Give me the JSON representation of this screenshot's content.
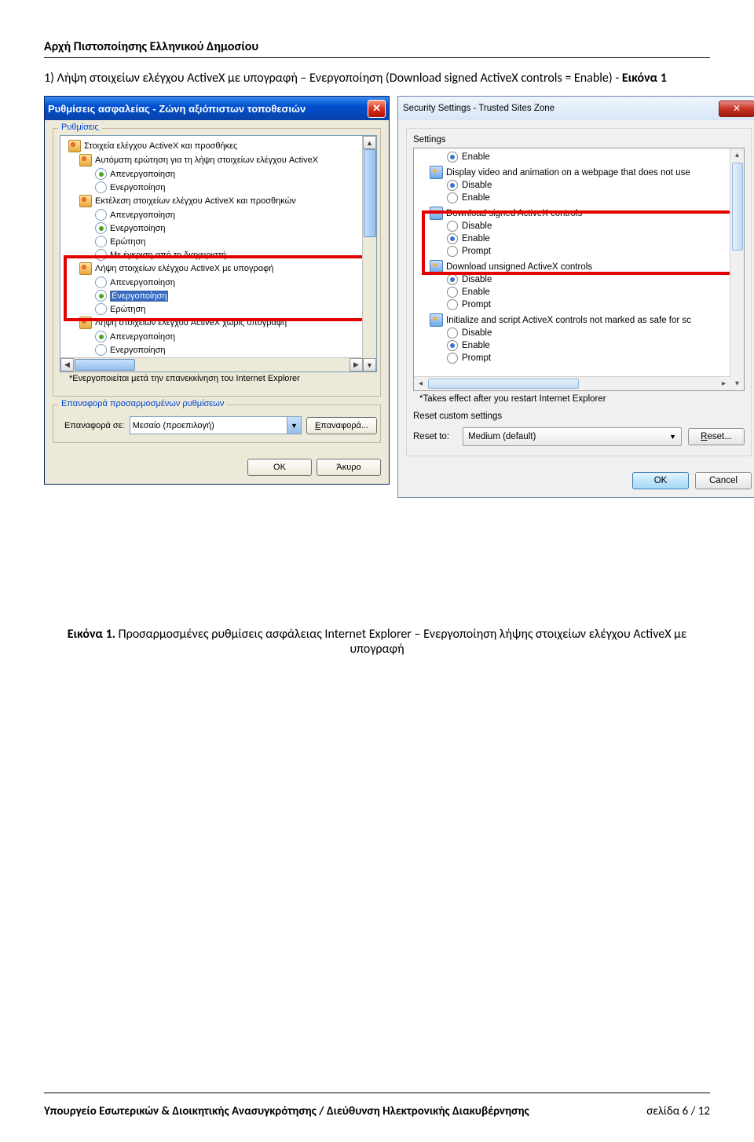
{
  "header": "Αρχή Πιστοποίησης Ελληνικού Δημοσίου",
  "paragraph_pre": "1) Λήψη στοιχείων ελέγχου ActiveX με υπογραφή – Ενεργοποίηση (Download signed ActiveX controls = Enable) - ",
  "paragraph_fig": "Εικόνα 1",
  "caption_lead": "Εικόνα 1.",
  "caption_rest": " Προσαρμοσμένες ρυθμίσεις ασφάλειας Internet Explorer – Ενεργοποίηση λήψης στοιχείων ελέγχου ActiveX με υπογραφή",
  "footer_left": "Υπουργείο Εσωτερικών & Διοικητικής Ανασυγκρότησης / Διεύθυνση Ηλεκτρονικής Διακυβέρνησης",
  "footer_right": "σελίδα 6 / 12",
  "dlg1": {
    "title": "Ρυθμίσεις ασφαλείας - Ζώνη αξιόπιστων τοποθεσιών",
    "group": "Ρυθμίσεις",
    "note": "*Ενεργοποιείται μετά την επανεκκίνηση του Internet Explorer",
    "reset_group": "Επαναφορά προσαρμοσμένων ρυθμίσεων",
    "reset_label": "Επαναφορά σε:",
    "reset_value": "Μεσαίο (προεπιλογή)",
    "reset_btn": "Επαναφορά...",
    "ok": "OK",
    "cancel": "Άκυρο",
    "c1": "Στοιχεία ελέγχου ActiveX και προσθήκες",
    "c2": "Αυτόματη ερώτηση για τη λήψη στοιχείων ελέγχου ActiveX",
    "c3": "Εκτέλεση στοιχείων ελέγχου ActiveX και προσθηκών",
    "c4": "Λήψη στοιχείων ελέγχου ActiveX με υπογραφή",
    "c5": "Λήψη στοιχείων ελέγχου ActiveX χωρίς υπογραφή",
    "o_disable": "Απενεργοποίηση",
    "o_enable": "Ενεργοποίηση",
    "o_prompt": "Ερώτηση",
    "o_admin": "Με έγκριση από το διαχειριστή"
  },
  "dlg2": {
    "title": "Security Settings - Trusted Sites Zone",
    "group": "Settings",
    "note": "*Takes effect after you restart Internet Explorer",
    "reset_group": "Reset custom settings",
    "reset_label": "Reset to:",
    "reset_value": "Medium (default)",
    "reset_btn": "Reset...",
    "ok": "OK",
    "cancel": "Cancel",
    "o_enable": "Enable",
    "o_disable": "Disable",
    "o_prompt": "Prompt",
    "c1": "Display video and animation on a webpage that does not use",
    "c2": "Download signed ActiveX controls",
    "c3": "Download unsigned ActiveX controls",
    "c4": "Initialize and script ActiveX controls not marked as safe for sc"
  }
}
